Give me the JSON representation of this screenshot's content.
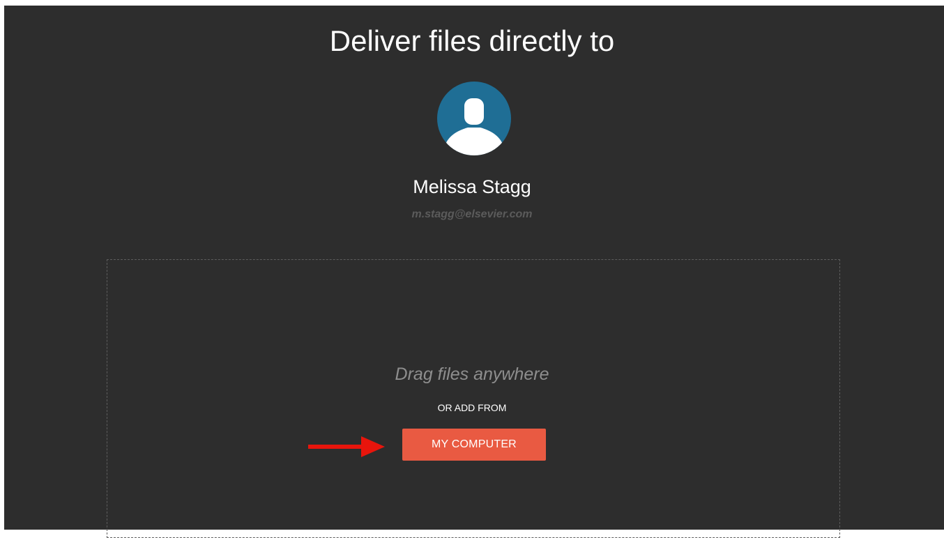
{
  "header": {
    "title": "Deliver files directly to"
  },
  "recipient": {
    "avatar_icon": "user-silhouette-icon",
    "name": "Melissa Stagg",
    "email": "m.stagg@elsevier.com"
  },
  "dropzone": {
    "drag_text": "Drag files anywhere",
    "or_add_label": "OR ADD FROM",
    "button_label": "MY COMPUTER"
  },
  "annotation": {
    "icon": "red-arrow-icon"
  },
  "colors": {
    "background": "#2d2d2d",
    "avatar_bg": "#1f6e95",
    "button": "#e95a42",
    "arrow": "#e8150c"
  }
}
